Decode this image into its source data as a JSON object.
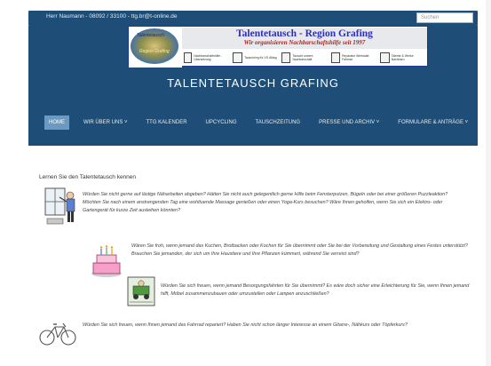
{
  "topbar": {
    "contact": "Herr Naumann - 08092 / 33100 - ttg.br@t-online.de",
    "search_placeholder": "Suchen"
  },
  "banner": {
    "logo_line1": "Talentetausch",
    "logo_line2": "Region Grafing",
    "title": "Talentetausch - Region Grafing",
    "subtitle": "Wir organisieren Nachbarschaftshilfe seit 1997",
    "icons": [
      {
        "name": "nachbarschaftshilfe-icon",
        "caption": "Nachbarschaftshilfe - Übersetzung"
      },
      {
        "name": "tauschring-icon",
        "caption": "Tauschring für VG Alltag"
      },
      {
        "name": "nachbarschaft-icon",
        "caption": "Tauscht unsere Nachbarschaft"
      },
      {
        "name": "fahrrad-icon",
        "caption": "Reparatur Werkstatt Fahrrad"
      },
      {
        "name": "talente-icon",
        "caption": "Talente & Werke Nachbarn"
      }
    ]
  },
  "site_title": "TALENTETAUSCH GRAFING",
  "nav": [
    {
      "label": "HOME",
      "active": true
    },
    {
      "label": "WIR ÜBER UNS ˅",
      "active": false
    },
    {
      "label": "TTG KALENDER",
      "active": false
    },
    {
      "label": "UPCYCLING",
      "active": false
    },
    {
      "label": "TAUSCHZEITUNG",
      "active": false
    },
    {
      "label": "PRESSE UND ARCHIV ˅",
      "active": false
    },
    {
      "label": "FORMULARE & ANTRÄGE ˅",
      "active": false
    }
  ],
  "content": {
    "intro": "Lernen Sie den Talentetausch kennen",
    "p1": "Würden Sie nicht gerne auf lästige Näharbeiten abgeben? Hätten Sie nicht auch gelegentlich gerne Hilfe beim Fensterputzen, Bügeln oder bei einer größeren Puzzleaktion? Möchten Sie nach einem anstrengenden Tag eine wohltuende Massage genießen oder einen Yoga-Kurs besuchen? Wäre Ihnen geholfen, wenn Sie sich ein Elektro- oder Gartengerät für kurze Zeit ausleihen könnten?",
    "p2": "Wären Sie froh, wenn jemand das Kuchen, Brotbacken oder Kochen für Sie übernimmt oder Sie bei der Vorbereitung und Gestaltung eines Festes unterstützt? Brauchen Sie jemanden, der sich um Ihre Haustiere und Ihre Pflanzen kümmert, während Sie verreist sind?",
    "p3": "Würden Sie sich freuen, wenn jemand Besorgungsfahrten für Sie übernimmt? Es wäre doch sicher eine Erleichterung für Sie, wenn Ihnen jemand hilft, Möbel zusammenzubauen oder umzustellen oder Lampen anzuschließen?",
    "p4": "Würden Sie sich freuen, wenn Ihnen jemand das Fahrrad repariert? Haben Sie nicht schon länger Interesse an einem Gitarre-, Nähkurs oder Töpferkurs?"
  }
}
